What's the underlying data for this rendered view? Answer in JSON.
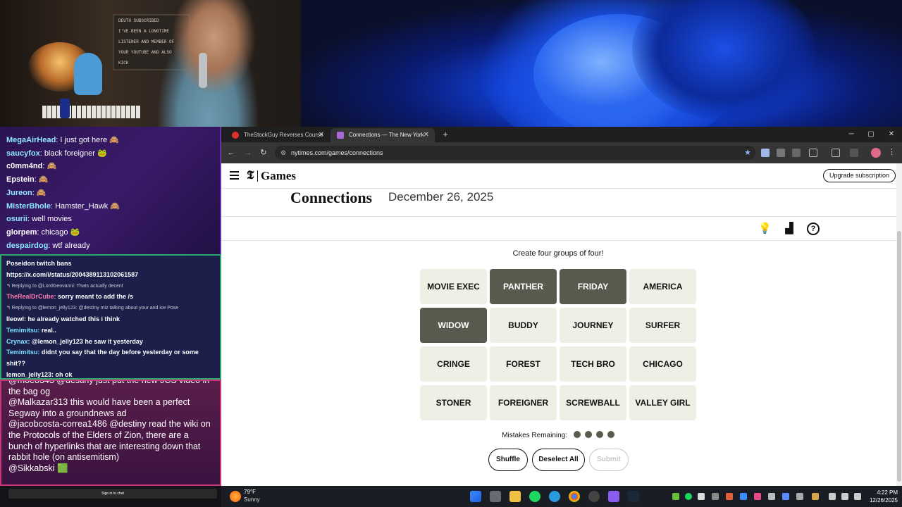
{
  "webcam": {
    "board_lines": [
      "DEUTH SUBSCRIBED",
      "I'VE BEEN A LONGTIME",
      "LISTENER AND MEMBER OF",
      "YOUR YOUTUBE AND ALSO",
      "KICK"
    ]
  },
  "chat_top": [
    {
      "user": "MegaAirHead",
      "color": "#8ee8ff",
      "text": ": I just got here 🙈"
    },
    {
      "user": "saucyfox",
      "color": "#8ee8ff",
      "text": ": black foreigner 🐸"
    },
    {
      "user": "c0mm4nd",
      "color": "#ffffff",
      "text": ": 🙈"
    },
    {
      "user": "Epstein",
      "color": "#ffffff",
      "text": ": 🙈"
    },
    {
      "user": "Jureon",
      "color": "#8ee8ff",
      "text": ": 🙈"
    },
    {
      "user": "MisterBhole",
      "color": "#8ee8ff",
      "text": ": Hamster_Hawk 🙈"
    },
    {
      "user": "osurii",
      "color": "#8ee8ff",
      "text": ": well movies"
    },
    {
      "user": "glorpem",
      "color": "#ffffff",
      "text": ": chicago 🐸"
    },
    {
      "user": "despairdog",
      "color": "#8ee8ff",
      "text": ": wtf already"
    }
  ],
  "chat_mid": {
    "l1": "Poseidon twitch bans",
    "l2": "https://x.com/i/status/2004389113102061587",
    "reply1": "↰ Replying to @LordGeovanni: Thats actually decent",
    "l3_user": "TheRealDrCube:",
    "l3_text": " sorry meant to add the /s",
    "reply2": "↰ Replying to @lemon_jelly123: @destiny miz talking about your and ice Pose",
    "l4": "lleowl: he already watched this i think",
    "l5_user": "Temimitsu:",
    "l5_text": " real..",
    "l6_user": "Crynax:",
    "l6_text": " @lemon_jelly123 he saw it yesterday",
    "l7_user": "Temimitsu:",
    "l7_text": " didnt you say that the day before yesterday or some shit??",
    "l8": "lemon_jelly123: oh ok"
  },
  "chat_bot": [
    {
      "user": "@moe8343",
      "text": " @destiny just put the new JCS video in the bag og"
    },
    {
      "user": "@Malkazar313",
      "text": " this would have been a perfect Segway into a groundnews ad"
    },
    {
      "user": "@jacobcosta-correa1486",
      "text": " @destiny read the wiki on the Protocols of the Elders of Zion, there are a bunch of hyperlinks that are interesting down that rabbit hole (on antisemitism)"
    },
    {
      "user": "@Sikkabski",
      "text": " 🟩"
    }
  ],
  "chat_signin": "Sign in to chat",
  "browser": {
    "tab1": "TheStockGuy Reverses Course",
    "tab2": "Connections — The New York",
    "url": "nytimes.com/games/connections",
    "new_tab": "+",
    "minimize": "─",
    "maximize": "▢",
    "close": "✕"
  },
  "page": {
    "logo": "𝕿",
    "section": "Games",
    "upgrade": "Upgrade subscription",
    "title": "Connections",
    "date": "December 26, 2025",
    "prompt": "Create four groups of four!",
    "mistakes_label": "Mistakes Remaining:",
    "mistakes_remaining": 4,
    "shuffle": "Shuffle",
    "deselect": "Deselect All",
    "submit": "Submit"
  },
  "tiles": [
    {
      "word": "MOVIE EXEC",
      "selected": false
    },
    {
      "word": "PANTHER",
      "selected": true
    },
    {
      "word": "FRIDAY",
      "selected": true
    },
    {
      "word": "AMERICA",
      "selected": false
    },
    {
      "word": "WIDOW",
      "selected": true
    },
    {
      "word": "BUDDY",
      "selected": false
    },
    {
      "word": "JOURNEY",
      "selected": false
    },
    {
      "word": "SURFER",
      "selected": false
    },
    {
      "word": "CRINGE",
      "selected": false
    },
    {
      "word": "FOREST",
      "selected": false
    },
    {
      "word": "TECH BRO",
      "selected": false
    },
    {
      "word": "CHICAGO",
      "selected": false
    },
    {
      "word": "STONER",
      "selected": false
    },
    {
      "word": "FOREIGNER",
      "selected": false
    },
    {
      "word": "SCREWBALL",
      "selected": false
    },
    {
      "word": "VALLEY GIRL",
      "selected": false
    }
  ],
  "taskbar": {
    "temp": "79°F",
    "weather": "Sunny",
    "time": "4:22 PM",
    "date": "12/26/2025"
  }
}
